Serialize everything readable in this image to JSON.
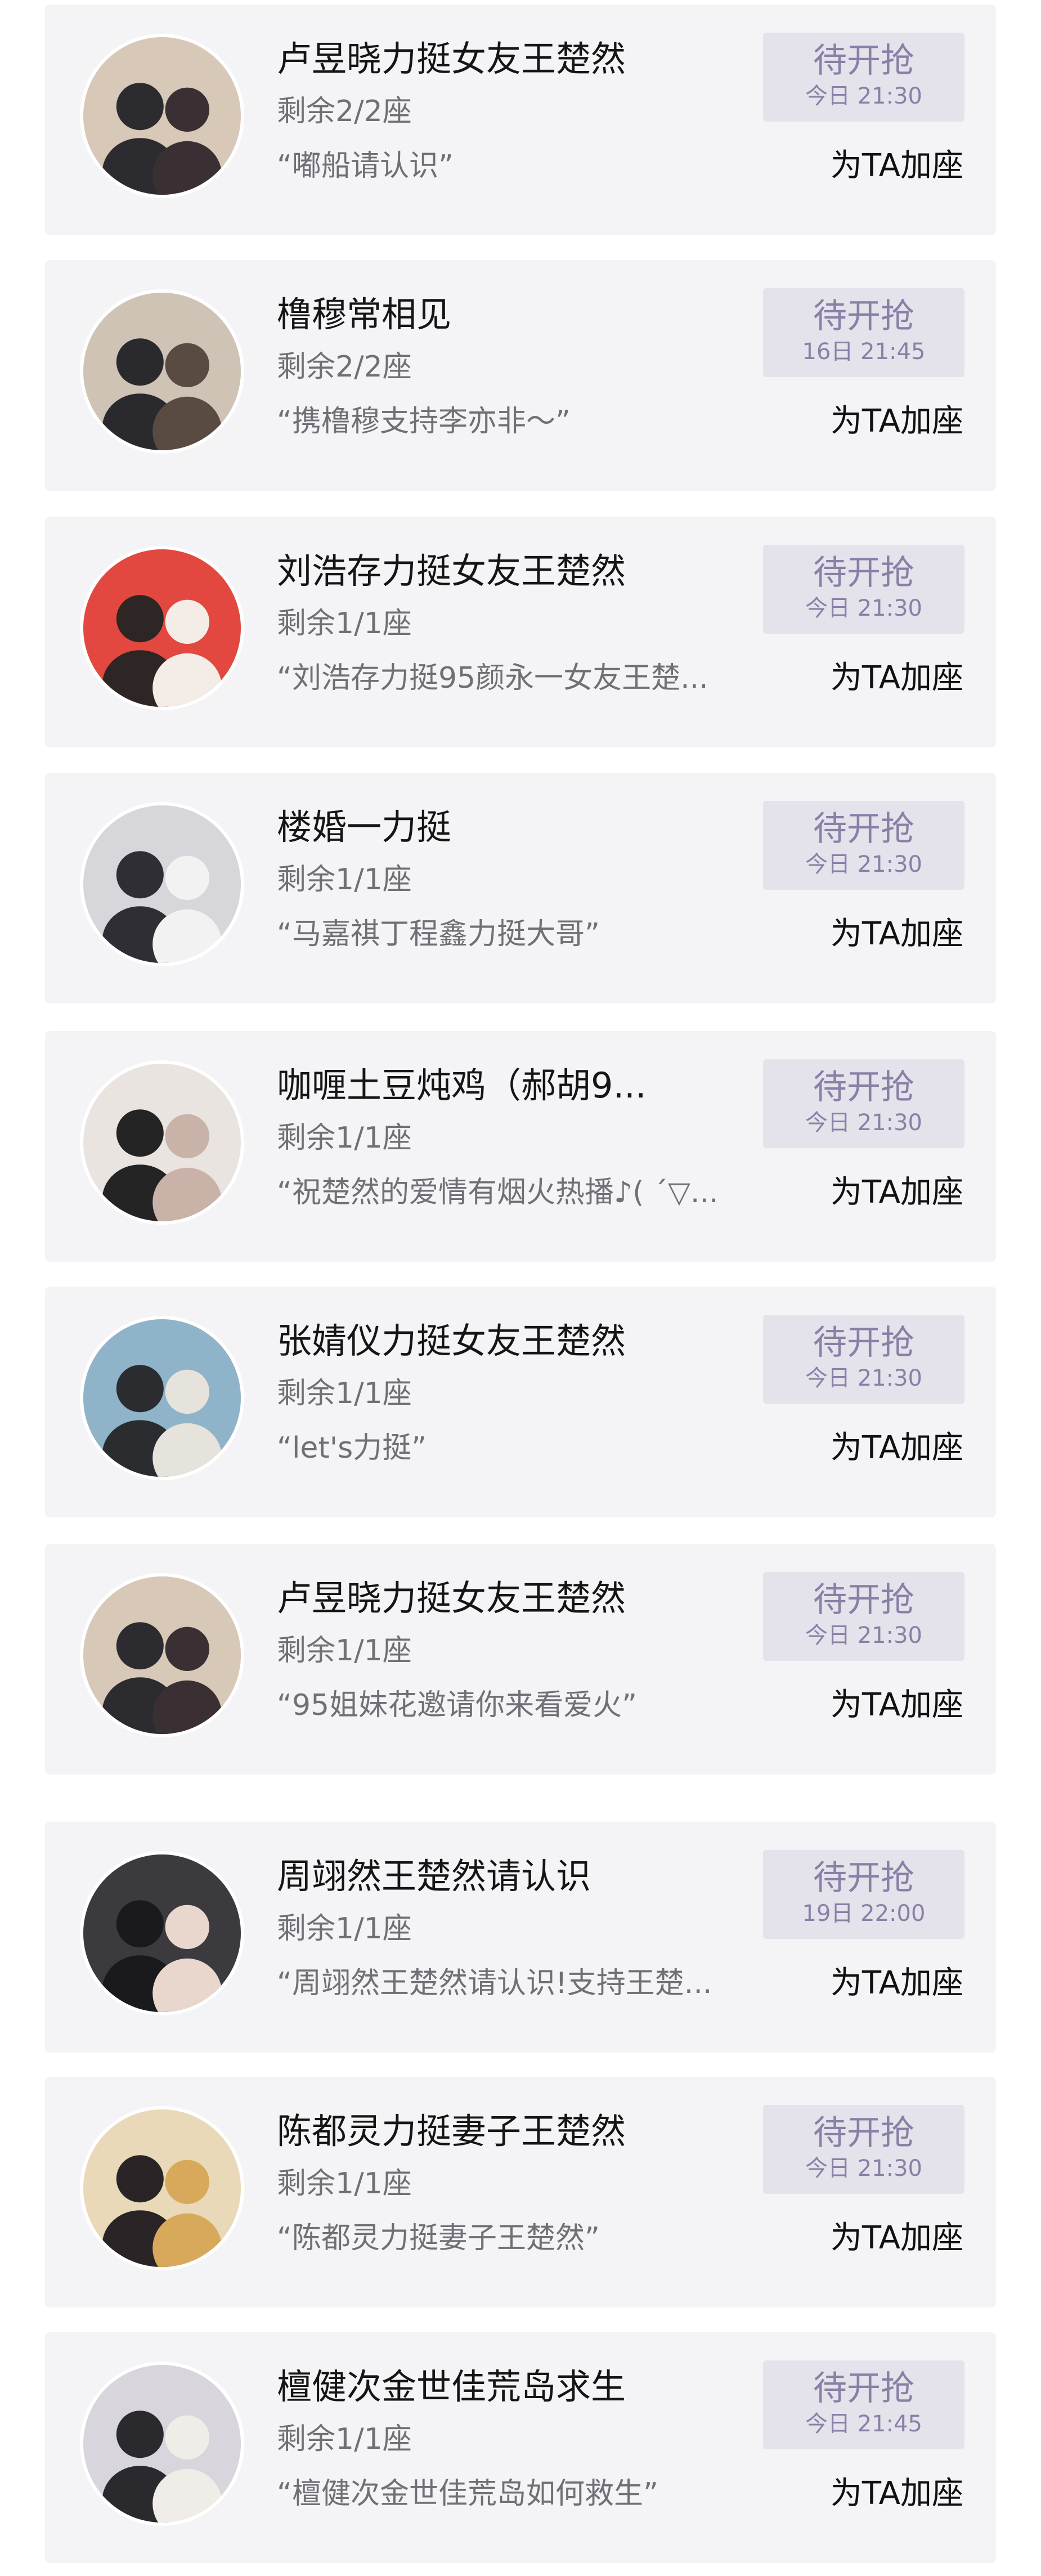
{
  "actions": {
    "add_seat_label": "为TA加座"
  },
  "cards": [
    {
      "title": "卢昱晓力挺女友王楚然",
      "seats": "剩余2/2座",
      "quote": "“嘟船请认识”",
      "button_label": "待开抢",
      "button_time": "今日 21:30",
      "avatar_bg": "#d8c8b8",
      "avatar_fg1": "#2c2c30",
      "avatar_fg2": "#3a3034"
    },
    {
      "title": "橹穆常相见",
      "seats": "剩余2/2座",
      "quote": "“携橹穆支持李亦非～”",
      "button_label": "待开抢",
      "button_time": "16日 21:45",
      "avatar_bg": "#cfc3b6",
      "avatar_fg1": "#2a2a2e",
      "avatar_fg2": "#5a4b42"
    },
    {
      "title": "刘浩存力挺女友王楚然",
      "seats": "剩余1/1座",
      "quote": "“刘浩存力挺95颜永一女友王楚...",
      "button_label": "待开抢",
      "button_time": "今日 21:30",
      "avatar_bg": "#e2483f",
      "avatar_fg1": "#2d2624",
      "avatar_fg2": "#f4ece6"
    },
    {
      "title": "楼婚一力挺",
      "seats": "剩余1/1座",
      "quote": "“马嘉祺丁程鑫力挺大哥”",
      "button_label": "待开抢",
      "button_time": "今日 21:30",
      "avatar_bg": "#d7d7db",
      "avatar_fg1": "#2e2e34",
      "avatar_fg2": "#f2f2f2"
    },
    {
      "title": "咖喱土豆炖鸡（郝胡9...",
      "seats": "剩余1/1座",
      "quote": "“祝楚然的爱情有烟火热播♪( ´▽...",
      "button_label": "待开抢",
      "button_time": "今日 21:30",
      "avatar_bg": "#e9e4e0",
      "avatar_fg1": "#242424",
      "avatar_fg2": "#c9b2a8"
    },
    {
      "title": "张婧仪力挺女友王楚然",
      "seats": "剩余1/1座",
      "quote": "“let's力挺”",
      "button_label": "待开抢",
      "button_time": "今日 21:30",
      "avatar_bg": "#8fb3c8",
      "avatar_fg1": "#2a2c30",
      "avatar_fg2": "#e6e2dc"
    },
    {
      "title": "卢昱晓力挺女友王楚然",
      "seats": "剩余1/1座",
      "quote": "“95姐妹花邀请你来看爱火”",
      "button_label": "待开抢",
      "button_time": "今日 21:30",
      "avatar_bg": "#d8c8b8",
      "avatar_fg1": "#2c2c30",
      "avatar_fg2": "#3a3034"
    },
    {
      "title": "周翊然王楚然请认识",
      "seats": "剩余1/1座",
      "quote": "“周翊然王楚然请认识!支持王楚...",
      "button_label": "待开抢",
      "button_time": "19日 22:00",
      "avatar_bg": "#3b3a3e",
      "avatar_fg1": "#1a1a1c",
      "avatar_fg2": "#e9d6cc"
    },
    {
      "title": "陈都灵力挺妻子王楚然",
      "seats": "剩余1/1座",
      "quote": "“陈都灵力挺妻子王楚然”",
      "button_label": "待开抢",
      "button_time": "今日 21:30",
      "avatar_bg": "#ead9b8",
      "avatar_fg1": "#2a2426",
      "avatar_fg2": "#d8a95a"
    },
    {
      "title": "檀健次金世佳荒岛求生",
      "seats": "剩余1/1座",
      "quote": "“檀健次金世佳荒岛如何救生”",
      "button_label": "待开抢",
      "button_time": "今日 21:45",
      "avatar_bg": "#d8d6dc",
      "avatar_fg1": "#2a2a2e",
      "avatar_fg2": "#f0ede8"
    }
  ]
}
